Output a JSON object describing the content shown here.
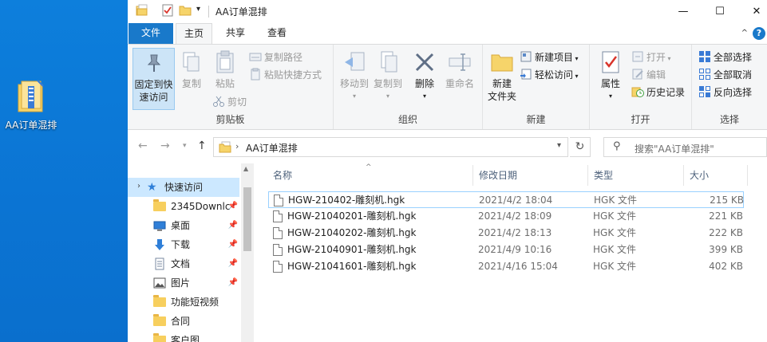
{
  "desktop": {
    "icon_label": "AA订单混排"
  },
  "titlebar": {
    "title": "AA订单混排",
    "dropdown_glyph": "▾",
    "minimize": "—",
    "maximize": "☐",
    "close": "✕"
  },
  "tabs": {
    "file": "文件",
    "home": "主页",
    "share": "共享",
    "view": "查看",
    "collapse_glyph": "^",
    "help_glyph": "?"
  },
  "ribbon": {
    "clipboard": {
      "label": "剪贴板",
      "pin_quick_access": "固定到快速访问",
      "pin_line1": "固定到快",
      "pin_line2": "速访问",
      "copy": "复制",
      "paste": "粘贴",
      "copy_path": "复制路径",
      "paste_shortcut": "粘贴快捷方式",
      "cut": "剪切"
    },
    "organize": {
      "label": "组织",
      "move_to": "移动到",
      "copy_to": "复制到",
      "delete": "删除",
      "rename": "重命名"
    },
    "new": {
      "label": "新建",
      "new_folder_line1": "新建",
      "new_folder_line2": "文件夹",
      "new_item": "新建项目",
      "easy_access": "轻松访问"
    },
    "open": {
      "label": "打开",
      "properties": "属性",
      "open": "打开",
      "edit": "编辑",
      "history": "历史记录"
    },
    "select": {
      "label": "选择",
      "select_all": "全部选择",
      "select_none": "全部取消",
      "invert": "反向选择"
    }
  },
  "address": {
    "path": "AA订单混排",
    "search_placeholder": "搜索\"AA订单混排\""
  },
  "navpane": {
    "items": [
      {
        "label": "快速访问",
        "pinned": false
      },
      {
        "label": "2345Downlc",
        "pinned": true
      },
      {
        "label": "桌面",
        "pinned": true
      },
      {
        "label": "下载",
        "pinned": true
      },
      {
        "label": "文档",
        "pinned": true
      },
      {
        "label": "图片",
        "pinned": true
      },
      {
        "label": "功能短视频",
        "pinned": false
      },
      {
        "label": "合同",
        "pinned": false
      },
      {
        "label": "客户图",
        "pinned": false
      }
    ]
  },
  "filelist": {
    "columns": {
      "name": "名称",
      "date": "修改日期",
      "type": "类型",
      "size": "大小"
    },
    "rows": [
      {
        "name": "HGW-210402-雕刻机.hgk",
        "date": "2021/4/2 18:04",
        "type": "HGK 文件",
        "size": "215 KB"
      },
      {
        "name": "HGW-21040201-雕刻机.hgk",
        "date": "2021/4/2 18:09",
        "type": "HGK 文件",
        "size": "221 KB"
      },
      {
        "name": "HGW-21040202-雕刻机.hgk",
        "date": "2021/4/2 18:13",
        "type": "HGK 文件",
        "size": "222 KB"
      },
      {
        "name": "HGW-21040901-雕刻机.hgk",
        "date": "2021/4/9 10:16",
        "type": "HGK 文件",
        "size": "399 KB"
      },
      {
        "name": "HGW-21041601-雕刻机.hgk",
        "date": "2021/4/16 15:04",
        "type": "HGK 文件",
        "size": "402 KB"
      }
    ]
  },
  "colors": {
    "accent": "#1979ca",
    "selection": "#cce8ff",
    "desktop": "#0a78d7"
  }
}
